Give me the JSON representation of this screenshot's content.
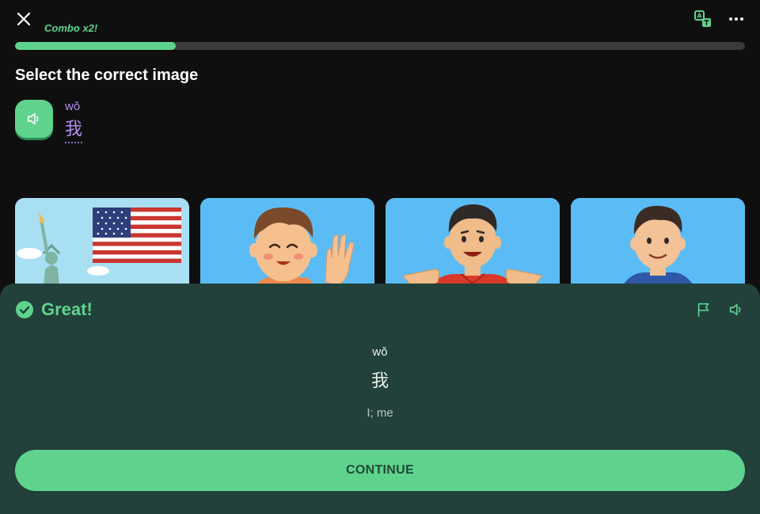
{
  "header": {
    "combo": "Combo x2!",
    "progress": 0.22,
    "icons": [
      "close-icon",
      "translate-icon",
      "more-icon"
    ]
  },
  "prompt": {
    "title": "Select the correct image",
    "pinyin": "wǒ",
    "hanzi": "我"
  },
  "options": [
    {
      "name": "usa-statue-of-liberty",
      "selected": false
    },
    {
      "name": "boy-waving",
      "selected": false
    },
    {
      "name": "man-pointing-at-self",
      "selected": true
    },
    {
      "name": "man-hand-on-chest",
      "selected": false
    }
  ],
  "feedback": {
    "status": "Great!",
    "pinyin": "wǒ",
    "hanzi": "我",
    "meaning": "I; me",
    "continue_label": "CONTINUE"
  },
  "colors": {
    "accent": "#5fd38d",
    "background": "#0f0f10",
    "sheet": "#22413a",
    "hanzi": "#b48ef0",
    "card": "#5bbcf5"
  }
}
